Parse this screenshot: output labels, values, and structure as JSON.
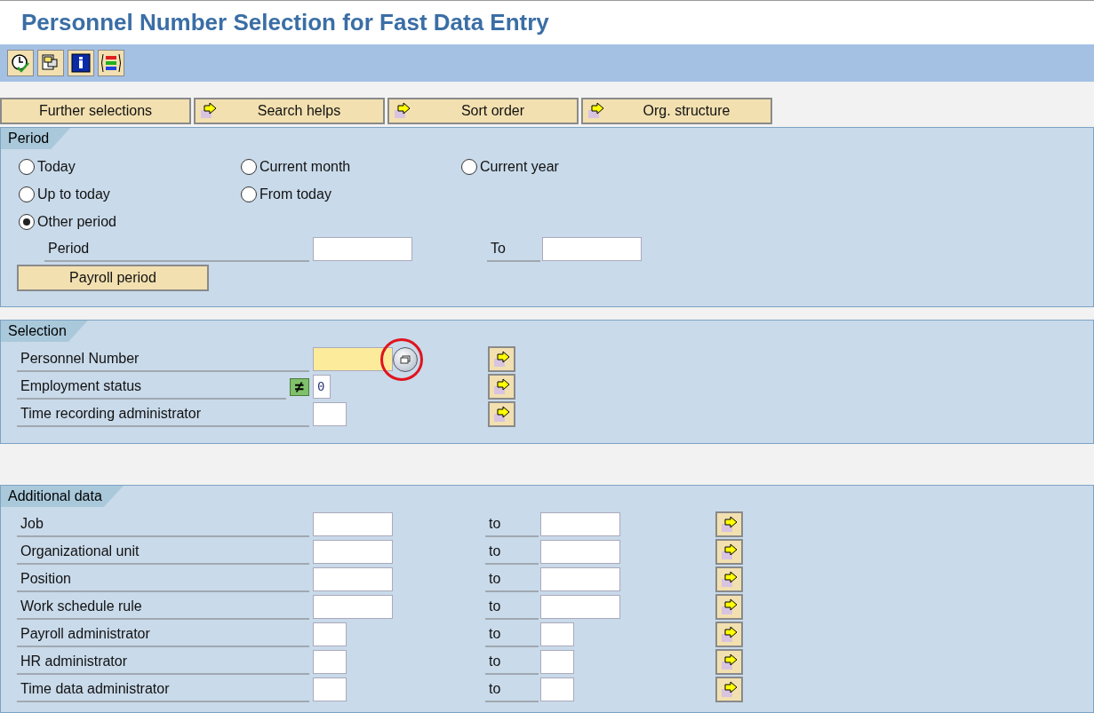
{
  "window": {
    "title": "Personnel Number Selection for Fast Data Entry"
  },
  "toolbar": [
    {
      "kind": "execute"
    },
    {
      "kind": "copy"
    },
    {
      "kind": "info"
    },
    {
      "kind": "columns"
    }
  ],
  "tab_buttons": [
    {
      "label": "Further selections",
      "arrow": false
    },
    {
      "label": "Search helps",
      "arrow": true
    },
    {
      "label": "Sort order",
      "arrow": true
    },
    {
      "label": "Org. structure",
      "arrow": true
    }
  ],
  "period": {
    "title": "Period",
    "radio_rows": [
      [
        {
          "label": "Today",
          "selected": false
        },
        {
          "label": "Current month",
          "selected": false
        },
        {
          "label": "Current year",
          "selected": false
        }
      ],
      [
        {
          "label": "Up to today",
          "selected": false
        },
        {
          "label": "From today",
          "selected": false
        }
      ],
      [
        {
          "label": "Other period",
          "selected": true
        }
      ]
    ],
    "field_label": "Period",
    "to_label": "To",
    "button": "Payroll period"
  },
  "selection": {
    "title": "Selection",
    "rows": [
      {
        "label": "Personnel Number",
        "kind": "wide",
        "highlighted": true,
        "search_help": true
      },
      {
        "label": "Employment status",
        "kind": "value",
        "operator": "≠",
        "value": "0"
      },
      {
        "label": "Time recording administrator",
        "kind": "narrow"
      }
    ]
  },
  "additional": {
    "title": "Additional data",
    "rows": [
      {
        "label": "Job",
        "to_label": "to",
        "kind": "wide"
      },
      {
        "label": "Organizational unit",
        "to_label": "to",
        "kind": "wide"
      },
      {
        "label": "Position",
        "to_label": "to",
        "kind": "wide"
      },
      {
        "label": "Work schedule rule",
        "to_label": "to",
        "kind": "wide"
      },
      {
        "label": "Payroll administrator",
        "to_label": "to",
        "kind": "narrow"
      },
      {
        "label": "HR administrator",
        "to_label": "to",
        "kind": "narrow"
      },
      {
        "label": "Time data administrator",
        "to_label": "to",
        "kind": "narrow"
      }
    ]
  }
}
